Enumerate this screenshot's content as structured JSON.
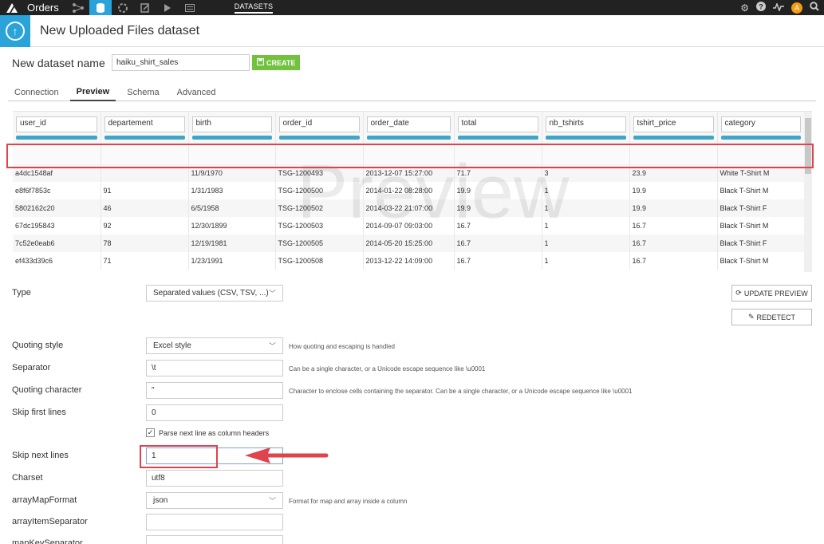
{
  "nav": {
    "project": "Orders",
    "section_label": "DATASETS",
    "avatar_letter": "A"
  },
  "header": {
    "title": "New Uploaded Files dataset"
  },
  "dataset": {
    "label": "New dataset name",
    "value": "haiku_shirt_sales",
    "create_label": "CREATE"
  },
  "tabs": [
    {
      "label": "Connection",
      "active": false
    },
    {
      "label": "Preview",
      "active": true
    },
    {
      "label": "Schema",
      "active": false
    },
    {
      "label": "Advanced",
      "active": false
    }
  ],
  "table": {
    "columns": [
      "user_id",
      "departement",
      "birth",
      "order_id",
      "order_date",
      "total",
      "nb_tshirts",
      "tshirt_price",
      "category"
    ],
    "rows": [
      [
        "a4dc1548af",
        "",
        "11/9/1970",
        "TSG-1200493",
        "2013-12-07 15:27:00",
        "71.7",
        "3",
        "23.9",
        "White T-Shirt M"
      ],
      [
        "e8f6f7853c",
        "91",
        "1/31/1983",
        "TSG-1200500",
        "2014-01-22 08:28:00",
        "19.9",
        "1",
        "19.9",
        "Black T-Shirt M"
      ],
      [
        "5802162c20",
        "46",
        "6/5/1958",
        "TSG-1200502",
        "2014-03-22 21:07:00",
        "19.9",
        "1",
        "19.9",
        "Black T-Shirt F"
      ],
      [
        "67dc195843",
        "92",
        "12/30/1899",
        "TSG-1200503",
        "2014-09-07 09:03:00",
        "16.7",
        "1",
        "16.7",
        "Black T-Shirt M"
      ],
      [
        "7c52e0eab6",
        "78",
        "12/19/1981",
        "TSG-1200505",
        "2014-05-20 15:25:00",
        "16.7",
        "1",
        "16.7",
        "Black T-Shirt F"
      ],
      [
        "ef433d39c6",
        "71",
        "1/23/1991",
        "TSG-1200508",
        "2013-12-22 14:09:00",
        "16.7",
        "1",
        "16.7",
        "Black T-Shirt M"
      ]
    ],
    "watermark": "Preview"
  },
  "form": {
    "type_label": "Type",
    "type_value": "Separated values (CSV, TSV, ...)",
    "update_preview": "UPDATE PREVIEW",
    "redetect": "REDETECT",
    "quoting_style_label": "Quoting style",
    "quoting_style_value": "Excel style",
    "quoting_style_help": "How quoting and escaping is handled",
    "separator_label": "Separator",
    "separator_value": "\\t",
    "separator_help": "Can be a single character, or a Unicode escape sequence like \\u0001",
    "quoting_char_label": "Quoting character",
    "quoting_char_value": "\"",
    "quoting_char_help": "Character to enclose cells containing the separator. Can be a single character, or a Unicode escape sequence like \\u0001",
    "skip_first_label": "Skip first lines",
    "skip_first_value": "0",
    "parse_header_label": "Parse next line as column headers",
    "skip_next_label": "Skip next lines",
    "skip_next_value": "1",
    "charset_label": "Charset",
    "charset_value": "utf8",
    "array_map_label": "arrayMapFormat",
    "array_map_value": "json",
    "array_map_help": "Format for map and array inside a column",
    "array_item_sep_label": "arrayItemSeparator",
    "array_item_sep_value": "",
    "map_key_sep_label": "mapKeySeparator"
  },
  "colors": {
    "accent": "#29a3d9",
    "create": "#72c240",
    "annotation": "#e0434b"
  }
}
